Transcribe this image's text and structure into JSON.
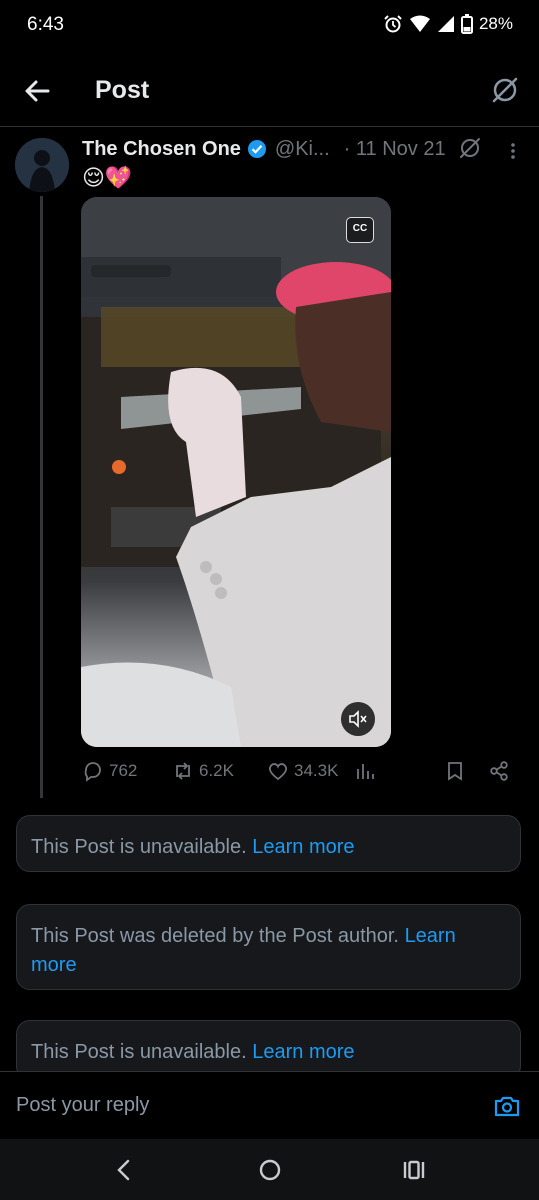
{
  "status_bar": {
    "time": "6:43",
    "battery": "28%"
  },
  "header": {
    "title": "Post"
  },
  "post": {
    "author_name": "The Chosen One",
    "handle": "@Ki...",
    "date": "· 11 Nov 21",
    "text": "😌💖",
    "media": {
      "cc_label": "CC"
    },
    "stats": {
      "replies": "762",
      "reposts": "6.2K",
      "likes": "34.3K"
    }
  },
  "notices": [
    {
      "text": "This Post is unavailable.",
      "link": "Learn more"
    },
    {
      "text": "This Post was deleted by the Post author.",
      "link": "Learn more"
    },
    {
      "text": "This Post is unavailable.",
      "link": "Learn more"
    }
  ],
  "reply": {
    "placeholder": "Post your reply"
  },
  "colors": {
    "accent": "#1d9bf0",
    "background": "#000000",
    "muted": "#71767b"
  }
}
